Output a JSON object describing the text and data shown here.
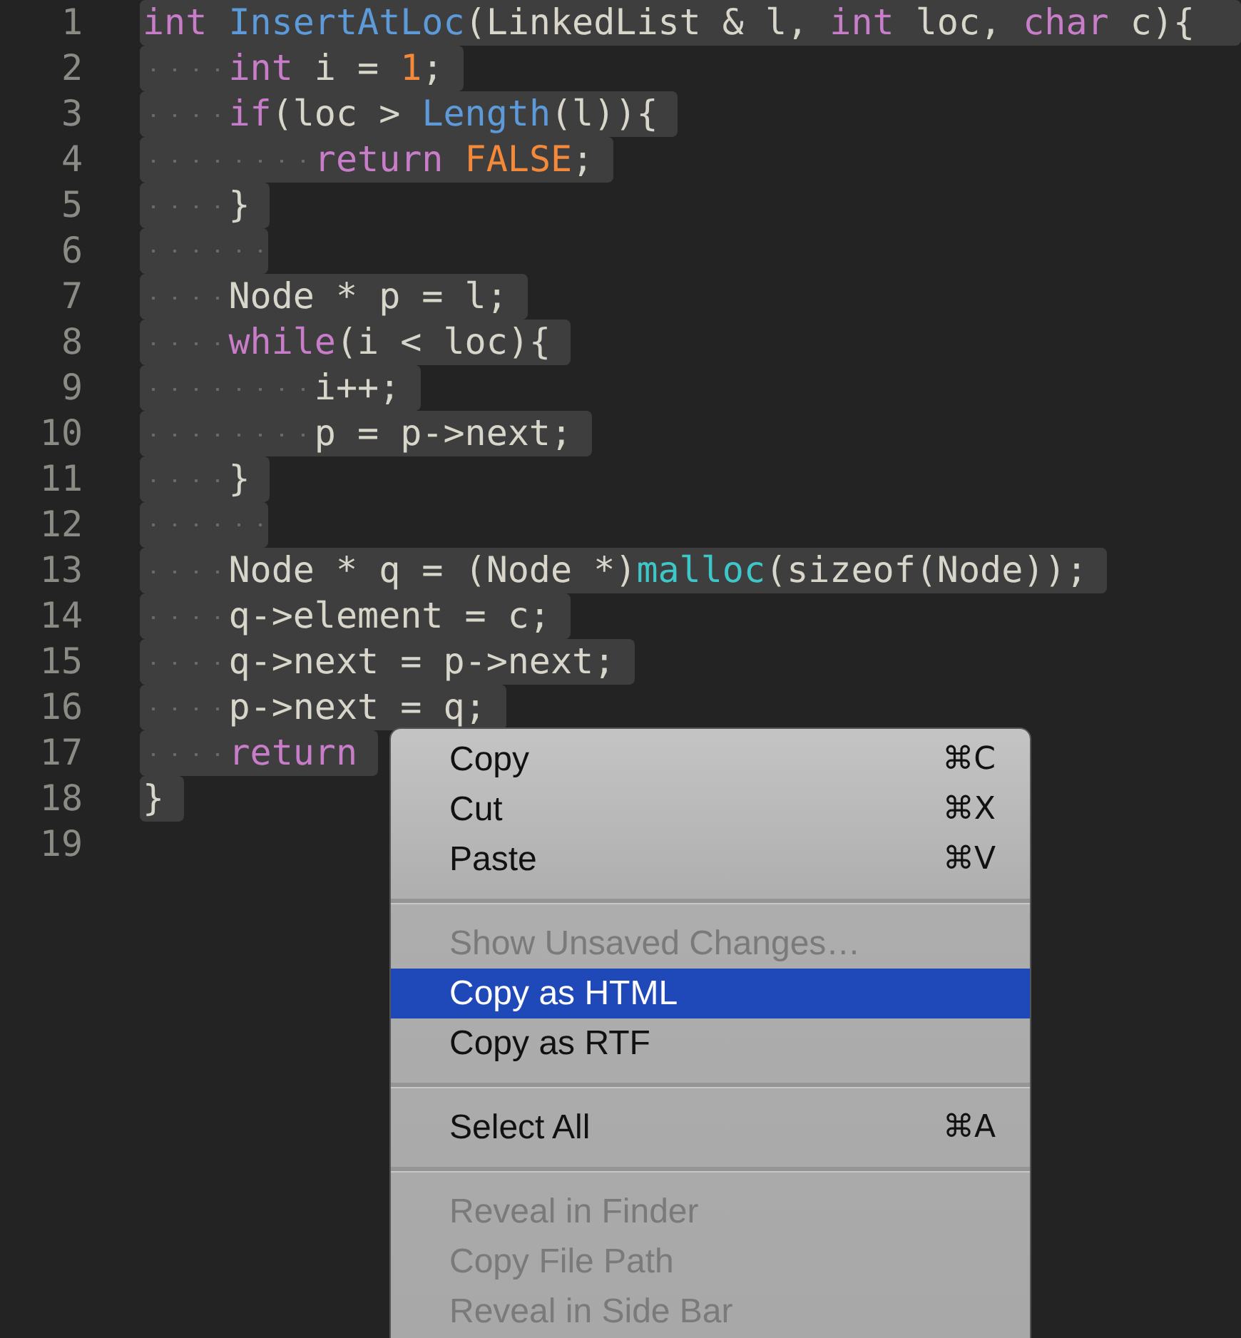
{
  "editor": {
    "lines": [
      {
        "number": "1",
        "selected": true,
        "tokens": [
          {
            "kind": "kw",
            "text": "int"
          },
          {
            "kind": "fn",
            "text": " InsertAtLoc"
          },
          {
            "kind": "plain",
            "text": "(LinkedList & l, "
          },
          {
            "kind": "kw",
            "text": "int"
          },
          {
            "kind": "plain",
            "text": " loc, "
          },
          {
            "kind": "kw",
            "text": "char"
          },
          {
            "kind": "plain",
            "text": " c){"
          }
        ]
      },
      {
        "number": "2",
        "selected": true,
        "tokens": [
          {
            "kind": "kw",
            "text": "    int"
          },
          {
            "kind": "plain",
            "text": " i = "
          },
          {
            "kind": "const",
            "text": "1"
          },
          {
            "kind": "plain",
            "text": ";"
          }
        ]
      },
      {
        "number": "3",
        "selected": true,
        "tokens": [
          {
            "kind": "kw",
            "text": "    if"
          },
          {
            "kind": "plain",
            "text": "(loc > "
          },
          {
            "kind": "fn",
            "text": "Length"
          },
          {
            "kind": "plain",
            "text": "(l)){"
          }
        ]
      },
      {
        "number": "4",
        "selected": true,
        "tokens": [
          {
            "kind": "kw",
            "text": "        return"
          },
          {
            "kind": "const",
            "text": " FALSE"
          },
          {
            "kind": "plain",
            "text": ";"
          }
        ]
      },
      {
        "number": "5",
        "selected": true,
        "tokens": [
          {
            "kind": "plain",
            "text": "    }"
          }
        ]
      },
      {
        "number": "6",
        "selected": true
      },
      {
        "number": "7",
        "selected": true,
        "tokens": [
          {
            "kind": "plain",
            "text": "    Node * p = l;"
          }
        ]
      },
      {
        "number": "8",
        "selected": true,
        "tokens": [
          {
            "kind": "kw",
            "text": "    while"
          },
          {
            "kind": "plain",
            "text": "(i < loc){"
          }
        ]
      },
      {
        "number": "9",
        "selected": true,
        "tokens": [
          {
            "kind": "plain",
            "text": "        i++;"
          }
        ]
      },
      {
        "number": "10",
        "selected": true,
        "tokens": [
          {
            "kind": "plain",
            "text": "        p = p->next;"
          }
        ]
      },
      {
        "number": "11",
        "selected": true,
        "tokens": [
          {
            "kind": "plain",
            "text": "    }"
          }
        ]
      },
      {
        "number": "12",
        "selected": true
      },
      {
        "number": "13",
        "selected": true,
        "tokens": [
          {
            "kind": "plain",
            "text": "    Node * q = (Node *)"
          },
          {
            "kind": "builtin",
            "text": "malloc"
          },
          {
            "kind": "plain",
            "text": "(sizeof(Node));"
          }
        ]
      },
      {
        "number": "14",
        "selected": true,
        "tokens": [
          {
            "kind": "plain",
            "text": "    q->element = c;"
          }
        ]
      },
      {
        "number": "15",
        "selected": true,
        "tokens": [
          {
            "kind": "plain",
            "text": "    q->next = p->next;"
          }
        ]
      },
      {
        "number": "16",
        "selected": true,
        "tokens": [
          {
            "kind": "plain",
            "text": "    p->next = q;"
          }
        ]
      },
      {
        "number": "17",
        "selected": true,
        "tokens": [
          {
            "kind": "kw",
            "text": "    return"
          }
        ]
      },
      {
        "number": "18",
        "selected": true,
        "tokens": [
          {
            "kind": "plain",
            "text": "}"
          }
        ]
      },
      {
        "number": "19",
        "selected": false
      }
    ]
  },
  "context_menu": {
    "items": [
      {
        "kind": "item",
        "label": "Copy",
        "shortcut": "⌘C",
        "disabled": false,
        "selected": false
      },
      {
        "kind": "item",
        "label": "Cut",
        "shortcut": "⌘X",
        "disabled": false,
        "selected": false
      },
      {
        "kind": "item",
        "label": "Paste",
        "shortcut": "⌘V",
        "disabled": false,
        "selected": false
      },
      {
        "kind": "separator"
      },
      {
        "kind": "item",
        "label": "Show Unsaved Changes…",
        "disabled": true,
        "selected": false
      },
      {
        "kind": "item",
        "label": "Copy as HTML",
        "disabled": false,
        "selected": true
      },
      {
        "kind": "item",
        "label": "Copy as RTF",
        "disabled": false,
        "selected": false
      },
      {
        "kind": "separator"
      },
      {
        "kind": "item",
        "label": "Select All",
        "shortcut": "⌘A",
        "disabled": false,
        "selected": false
      },
      {
        "kind": "separator"
      },
      {
        "kind": "item",
        "label": "Reveal in Finder",
        "disabled": true,
        "selected": false
      },
      {
        "kind": "item",
        "label": "Copy File Path",
        "disabled": true,
        "selected": false
      },
      {
        "kind": "item",
        "label": "Reveal in Side Bar",
        "disabled": true,
        "selected": false
      }
    ]
  }
}
